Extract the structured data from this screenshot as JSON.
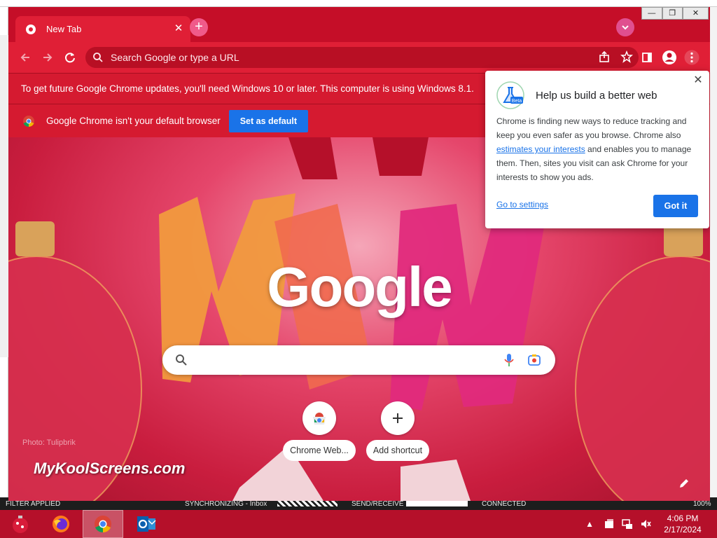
{
  "background_app": {
    "status": {
      "filter": "FILTER APPLIED",
      "sync": "SYNCHRONIZING - Inbox",
      "send_receive": "SEND/RECEIVE",
      "connection": "CONNECTED",
      "zoom": "100%"
    }
  },
  "browser": {
    "tab": {
      "title": "New Tab"
    },
    "omnibox": {
      "placeholder": "Search Google or type a URL"
    },
    "infobar_update": {
      "text": "To get future Google Chrome updates, you'll need Windows 10 or later. This computer is using Windows 8.1."
    },
    "infobar_default": {
      "text": "Google Chrome isn't your default browser",
      "button": "Set as default"
    }
  },
  "ntp": {
    "logo": "Google",
    "shortcuts": [
      {
        "label": "Chrome Web..."
      },
      {
        "label": "Add shortcut"
      }
    ],
    "watermark": "MyKoolScreens.com",
    "photo_credit": "Photo: Tulipbrik"
  },
  "privacy_bubble": {
    "badge": "Beta",
    "title": "Help us build a better web",
    "body_part1": "Chrome is finding new ways to reduce tracking and keep you even safer as you browse. Chrome also ",
    "body_link": "estimates your interests",
    "body_part2": " and enables you to manage them. Then, sites you visit can ask Chrome for your interests to show you ads.",
    "settings_link": "Go to settings",
    "button": "Got it"
  },
  "taskbar": {
    "time": "4:06 PM",
    "date": "2/17/2024"
  },
  "colors": {
    "accent_blue": "#1a73e8",
    "theme_red": "#c50e28"
  }
}
